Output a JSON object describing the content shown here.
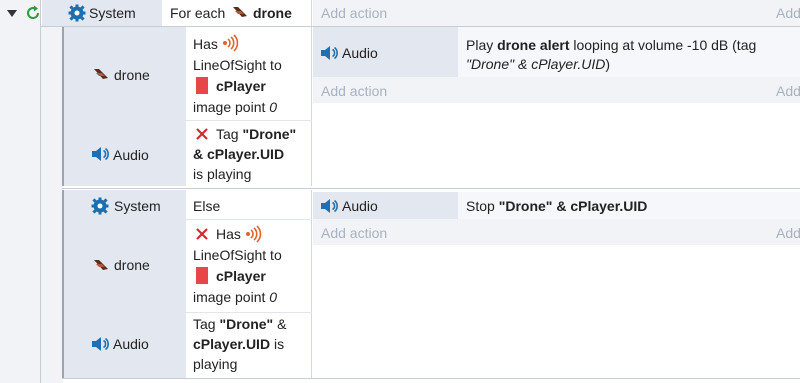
{
  "event1": {
    "object": "System",
    "condition_prefix": "For each",
    "condition_object": "drone",
    "add_action": "Add action",
    "add_action_right": "Add"
  },
  "sub1": {
    "cond1": {
      "object": "drone",
      "has": "Has",
      "los": "LineOfSight to",
      "target": "cPlayer",
      "image_point": "image point",
      "image_point_value": "0"
    },
    "cond2": {
      "object": "Audio",
      "tag_word": "Tag",
      "tag_name": "\"Drone\"",
      "tag_uid": "& cPlayer.UID",
      "is_playing": "is playing"
    },
    "action": {
      "object": "Audio",
      "play": "Play",
      "sound": "drone alert",
      "loop_text": "looping at volume -10 dB (tag",
      "tag_text": "\"Drone\" & cPlayer.UID",
      "close": ")"
    },
    "add_action": "Add action",
    "add_action_right": "Add"
  },
  "sub2": {
    "cond1": {
      "object": "System",
      "text": "Else"
    },
    "cond2": {
      "object": "drone",
      "has": "Has",
      "los": "LineOfSight to",
      "target": "cPlayer",
      "image_point": "image point",
      "image_point_value": "0"
    },
    "cond3": {
      "object": "Audio",
      "tag_word": "Tag",
      "tag_name": "\"Drone\"",
      "amp": "&",
      "tag_uid": "cPlayer.UID",
      "is": "is",
      "playing": "playing"
    },
    "action": {
      "object": "Audio",
      "stop": "Stop",
      "tag_text": "\"Drone\" & cPlayer.UID"
    },
    "add_action": "Add action",
    "add_action_right": "Add"
  },
  "colors": {
    "accent_blue": "#1f6fb4",
    "gear_blue": "#1a6fb0",
    "invert_red": "#d12c2c",
    "loop_green": "#2f9a3a",
    "player_red": "#e8474a"
  }
}
